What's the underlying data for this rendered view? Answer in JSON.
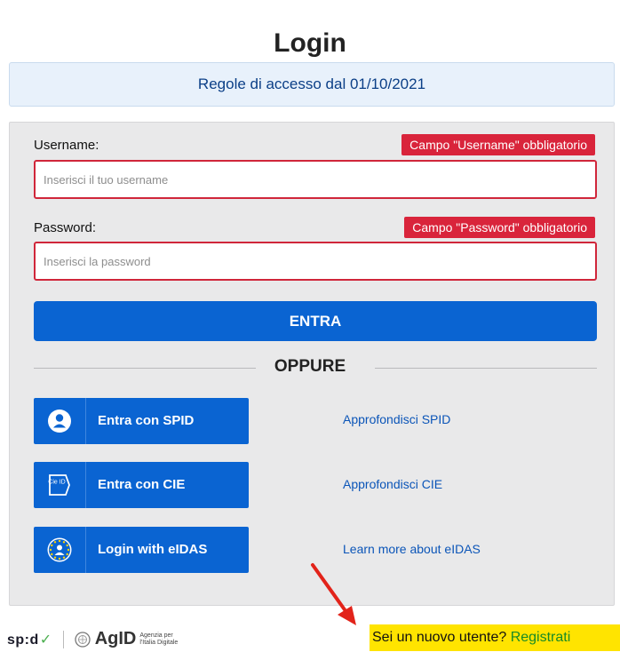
{
  "page": {
    "title": "Login"
  },
  "rules_banner": {
    "label": "Regole di accesso dal 01/10/2021"
  },
  "form": {
    "username": {
      "label": "Username:",
      "error": "Campo \"Username\" obbligatorio",
      "value": "",
      "placeholder": "Inserisci il tuo username"
    },
    "password": {
      "label": "Password:",
      "error": "Campo \"Password\" obbligatorio",
      "value": "",
      "placeholder": "Inserisci la password"
    },
    "submit_label": "ENTRA",
    "separator_label": "OPPURE"
  },
  "identity_providers": [
    {
      "button_label": "Entra con SPID",
      "learn_more": "Approfondisci SPID",
      "icon": "user-circle-icon"
    },
    {
      "button_label": "Entra con CIE",
      "learn_more": "Approfondisci CIE",
      "icon": "cie-id-icon",
      "icon_text": "Cie ID"
    },
    {
      "button_label": "Login with eIDAS",
      "learn_more": "Learn more about eIDAS",
      "icon": "eidas-stars-icon"
    }
  ],
  "footer": {
    "spid_logo": "sp:d",
    "agid_logo": "AgID",
    "agid_subtitle": "Agenzia per l'Italia Digitale",
    "register_prompt": "Sei un nuovo utente? ",
    "register_link": "Registrati"
  },
  "colors": {
    "primary": "#0a64d2",
    "error": "#d9243b",
    "banner_bg": "#e8f1fb",
    "panel_bg": "#e9e9ea",
    "highlight": "#ffe400",
    "annotation_arrow": "#e2231a",
    "link_green": "#178a26"
  }
}
